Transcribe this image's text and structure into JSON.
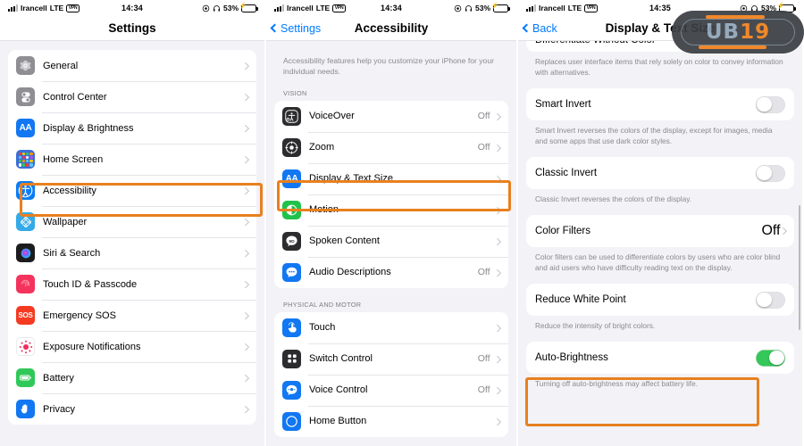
{
  "watermark": {
    "text_primary": "UB",
    "text_secondary": "19",
    "pill_color": "#3b3f44",
    "accent": "#f07f1a"
  },
  "accent_highlight": "#e8801f",
  "panels": [
    {
      "id": "settings",
      "statusbar": {
        "carrier": "Irancell",
        "network": "LTE",
        "vpn": "VPN",
        "time": "14:34",
        "battery_pct": "53%"
      },
      "nav": {
        "title": "Settings",
        "back_label": ""
      },
      "groups": [
        {
          "rows": [
            {
              "label": "General",
              "value": "",
              "icon": "gear-icon",
              "chevron": true
            },
            {
              "label": "Control Center",
              "value": "",
              "icon": "control-center-icon",
              "chevron": true
            },
            {
              "label": "Display & Brightness",
              "value": "",
              "icon": "display-brightness-icon",
              "chevron": true
            },
            {
              "label": "Home Screen",
              "value": "",
              "icon": "home-screen-icon",
              "chevron": true
            },
            {
              "label": "Accessibility",
              "value": "",
              "icon": "accessibility-icon",
              "chevron": true
            },
            {
              "label": "Wallpaper",
              "value": "",
              "icon": "wallpaper-icon",
              "chevron": true
            },
            {
              "label": "Siri & Search",
              "value": "",
              "icon": "siri-icon",
              "chevron": true
            },
            {
              "label": "Touch ID & Passcode",
              "value": "",
              "icon": "touch-id-icon",
              "chevron": true
            },
            {
              "label": "Emergency SOS",
              "value": "",
              "icon": "sos-icon",
              "chevron": true
            },
            {
              "label": "Exposure Notifications",
              "value": "",
              "icon": "exposure-notifications-icon",
              "chevron": true
            },
            {
              "label": "Battery",
              "value": "",
              "icon": "battery-icon",
              "chevron": true
            },
            {
              "label": "Privacy",
              "value": "",
              "icon": "privacy-hand-icon",
              "chevron": true
            }
          ]
        }
      ]
    },
    {
      "id": "accessibility",
      "statusbar": {
        "carrier": "Irancell",
        "network": "LTE",
        "vpn": "VPN",
        "time": "14:34",
        "battery_pct": "53%"
      },
      "nav": {
        "title": "Accessibility",
        "back_label": "Settings"
      },
      "intro": "Accessibility features help you customize your iPhone for your individual needs.",
      "groups": [
        {
          "header": "VISION",
          "rows": [
            {
              "label": "VoiceOver",
              "value": "Off",
              "icon": "voiceover-icon",
              "chevron": true
            },
            {
              "label": "Zoom",
              "value": "Off",
              "icon": "zoom-icon",
              "chevron": true
            },
            {
              "label": "Display & Text Size",
              "value": "",
              "icon": "display-text-size-icon",
              "chevron": true
            },
            {
              "label": "Motion",
              "value": "",
              "icon": "motion-icon",
              "chevron": true
            },
            {
              "label": "Spoken Content",
              "value": "",
              "icon": "spoken-content-icon",
              "chevron": true
            },
            {
              "label": "Audio Descriptions",
              "value": "Off",
              "icon": "audio-descriptions-icon",
              "chevron": true
            }
          ]
        },
        {
          "header": "PHYSICAL AND MOTOR",
          "rows": [
            {
              "label": "Touch",
              "value": "",
              "icon": "touch-icon",
              "chevron": true
            },
            {
              "label": "Switch Control",
              "value": "Off",
              "icon": "switch-control-icon",
              "chevron": true
            },
            {
              "label": "Voice Control",
              "value": "Off",
              "icon": "voice-control-icon",
              "chevron": true
            },
            {
              "label": "Home Button",
              "value": "",
              "icon": "home-button-icon",
              "chevron": true
            }
          ]
        }
      ]
    },
    {
      "id": "display-text-size",
      "statusbar": {
        "carrier": "Irancell",
        "network": "LTE",
        "vpn": "VPN",
        "time": "14:35",
        "battery_pct": "53%"
      },
      "nav": {
        "title": "Display & Text Size",
        "back_label": "Back"
      },
      "sections": [
        {
          "type": "row-partial",
          "label": "Differentiate Without Color",
          "footnote": "Replaces user interface items that rely solely on color to convey information with alternatives."
        },
        {
          "type": "toggle",
          "label": "Smart Invert",
          "on": false,
          "footnote": "Smart Invert reverses the colors of the display, except for images, media and some apps that use dark color styles."
        },
        {
          "type": "toggle",
          "label": "Classic Invert",
          "on": false,
          "footnote": "Classic Invert reverses the colors of the display."
        },
        {
          "type": "link",
          "label": "Color Filters",
          "value": "Off",
          "footnote": "Color filters can be used to differentiate colors by users who are color blind and aid users who have difficulty reading text on the display."
        },
        {
          "type": "toggle",
          "label": "Reduce White Point",
          "on": false,
          "footnote": "Reduce the intensity of bright colors."
        },
        {
          "type": "toggle",
          "label": "Auto-Brightness",
          "on": true,
          "footnote": "Turning off auto-brightness may affect battery life."
        }
      ]
    }
  ]
}
